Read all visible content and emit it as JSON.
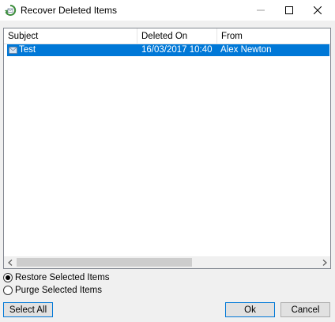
{
  "window": {
    "title": "Recover Deleted Items",
    "icon": "recycle-mail-icon",
    "controls": [
      "minimize-icon",
      "maximize-icon",
      "close-icon"
    ]
  },
  "list": {
    "columns": {
      "subject": "Subject",
      "deleted_on": "Deleted On",
      "from": "From"
    },
    "rows": [
      {
        "subject": "Test",
        "deleted_on": "16/03/2017 10:40",
        "from": "Alex Newton",
        "selected": true,
        "icon": "envelope-icon"
      }
    ],
    "selection_color": "#0078d7"
  },
  "options": {
    "restore_label": "Restore Selected Items",
    "purge_label": "Purge Selected Items",
    "selected": "restore"
  },
  "buttons": {
    "select_all": "Select All",
    "ok": "Ok",
    "cancel": "Cancel"
  }
}
